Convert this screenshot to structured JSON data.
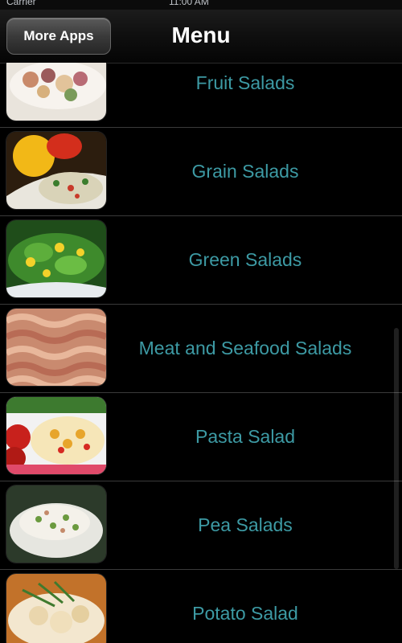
{
  "status_bar": {
    "carrier": "Carrier",
    "time": "11:00 AM"
  },
  "navbar": {
    "left_button": "More Apps",
    "title": "Menu"
  },
  "menu_items": [
    {
      "label": "Fruit Salads",
      "icon": "fruit-salad-photo"
    },
    {
      "label": "Grain Salads",
      "icon": "grain-salad-photo"
    },
    {
      "label": "Green Salads",
      "icon": "green-salad-photo"
    },
    {
      "label": "Meat and Seafood Salads",
      "icon": "meat-seafood-salad-photo"
    },
    {
      "label": "Pasta Salad",
      "icon": "pasta-salad-photo"
    },
    {
      "label": "Pea Salads",
      "icon": "pea-salad-photo"
    },
    {
      "label": "Potato Salad",
      "icon": "potato-salad-photo"
    }
  ],
  "colors": {
    "label": "#3d9aa4",
    "background": "#000000",
    "separator": "#3a3a3a"
  }
}
